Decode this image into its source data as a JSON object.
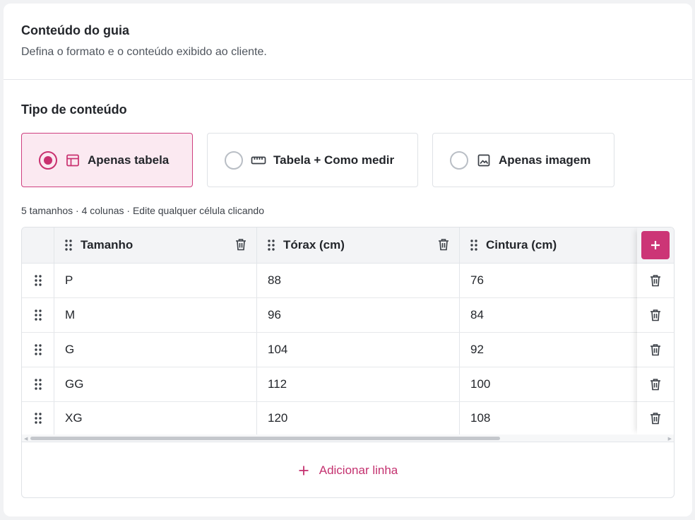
{
  "header": {
    "title": "Conteúdo do guia",
    "subtitle": "Defina o formato e o conteúdo exibido ao cliente."
  },
  "content_type": {
    "title": "Tipo de conteúdo",
    "options": [
      {
        "label": "Apenas tabela",
        "icon": "table-icon",
        "selected": true
      },
      {
        "label": "Tabela + Como medir",
        "icon": "ruler-icon",
        "selected": false
      },
      {
        "label": "Apenas imagem",
        "icon": "image-icon",
        "selected": false
      }
    ]
  },
  "info": "5 tamanhos · 4 colunas · Edite qualquer célula clicando",
  "table": {
    "columns": [
      "Tamanho",
      "Tórax (cm)",
      "Cintura (cm)"
    ],
    "rows": [
      [
        "P",
        "88",
        "76"
      ],
      [
        "M",
        "96",
        "84"
      ],
      [
        "G",
        "104",
        "92"
      ],
      [
        "GG",
        "112",
        "100"
      ],
      [
        "XG",
        "120",
        "108"
      ]
    ]
  },
  "add_row_label": "Adicionar linha",
  "colors": {
    "accent": "#cc3576",
    "selected_bg": "#fbe9f1",
    "selected_border": "#cf3f7f"
  }
}
